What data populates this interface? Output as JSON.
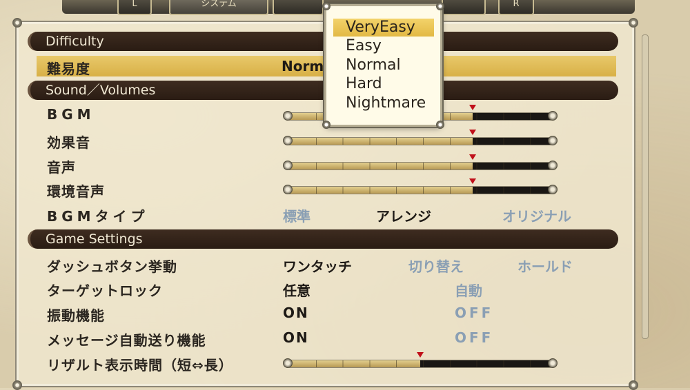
{
  "difficulty_section": {
    "header": "Difficulty",
    "label": "難易度",
    "current_value": "Normal",
    "options": [
      "VeryEasy",
      "Easy",
      "Normal",
      "Hard",
      "Nightmare"
    ],
    "highlighted_option": "VeryEasy"
  },
  "sound_section": {
    "header": "Sound／Volumes",
    "sliders": [
      {
        "label": "BGM",
        "level_percent": 70
      },
      {
        "label": "効果音",
        "level_percent": 70
      },
      {
        "label": "音声",
        "level_percent": 70
      },
      {
        "label": "環境音声",
        "level_percent": 70
      }
    ],
    "bgm_type": {
      "label": "BGMタイプ",
      "options": [
        "標準",
        "アレンジ",
        "オリジナル"
      ],
      "selected": "アレンジ"
    }
  },
  "game_section": {
    "header": "Game Settings",
    "dash": {
      "label": "ダッシュボタン挙動",
      "options": [
        "ワンタッチ",
        "切り替え",
        "ホールド"
      ],
      "selected": "ワンタッチ"
    },
    "target_lock": {
      "label": "ターゲットロック",
      "options": [
        "任意",
        "自動"
      ],
      "selected": "任意"
    },
    "vibration": {
      "label": "振動機能",
      "options": [
        "ON",
        "OFF"
      ],
      "selected": "ON"
    },
    "auto_message": {
      "label": "メッセージ自動送り機能",
      "options": [
        "ON",
        "OFF"
      ],
      "selected": "ON"
    },
    "result_time": {
      "label": "リザルト表示時間（短⇔長）",
      "level_percent": 50
    }
  },
  "tabs": {
    "left_button": "L",
    "system_tab": "システム",
    "right_button": "R"
  },
  "colors": {
    "section_header_bg": "#2f2018",
    "highlight": "#e6c35c",
    "selected_text": "#1e1a16",
    "unselected_text": "#8a9fb4",
    "marker": "#c0101a"
  }
}
